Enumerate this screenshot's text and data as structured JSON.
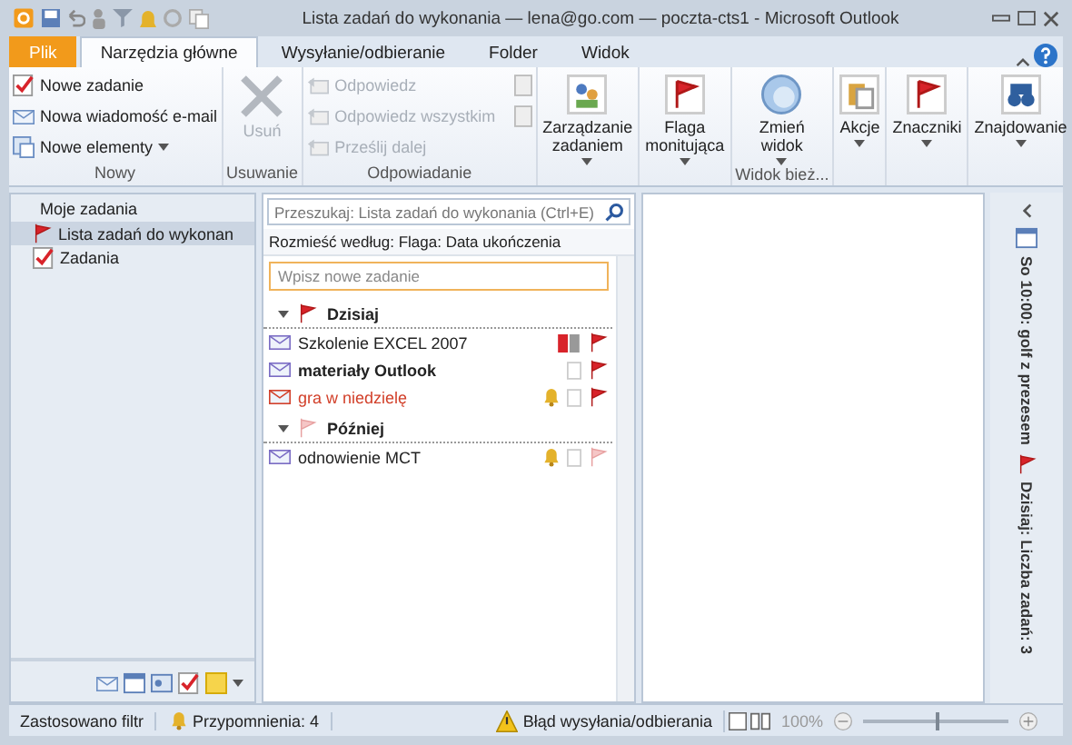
{
  "window": {
    "title": "Lista zadań do wykonania — lena@go.com — poczta-cts1 - Microsoft Outlook"
  },
  "tabs": [
    {
      "label": "Plik",
      "kind": "file",
      "selected": false
    },
    {
      "label": "Narzędzia główne",
      "kind": "tab",
      "selected": true
    },
    {
      "label": "Wysyłanie/odbieranie",
      "kind": "tab",
      "selected": false
    },
    {
      "label": "Folder",
      "kind": "tab",
      "selected": false
    },
    {
      "label": "Widok",
      "kind": "tab",
      "selected": false
    }
  ],
  "ribbon": {
    "groups": [
      {
        "label": "Nowy",
        "kind": "small",
        "buttons": [
          {
            "label": "Nowe zadanie",
            "disabled": false,
            "dropdown": false
          },
          {
            "label": "Nowa wiadomość e-mail",
            "disabled": false,
            "dropdown": false
          },
          {
            "label": "Nowe elementy",
            "disabled": false,
            "dropdown": true
          }
        ]
      },
      {
        "label": "Usuwanie",
        "kind": "large",
        "buttons": [
          {
            "label": "Usuń",
            "disabled": true,
            "dropdown": false
          }
        ]
      },
      {
        "label": "Odpowiadanie",
        "kind": "small",
        "buttons": [
          {
            "label": "Odpowiedz",
            "disabled": true,
            "dropdown": false
          },
          {
            "label": "Odpowiedz wszystkim",
            "disabled": true,
            "dropdown": false
          },
          {
            "label": "Prześlij dalej",
            "disabled": true,
            "dropdown": false
          }
        ]
      },
      {
        "kind": "large",
        "buttons": [
          {
            "label": "Zarządzanie zadaniem",
            "disabled": false,
            "dropdown": true
          }
        ]
      },
      {
        "kind": "large",
        "buttons": [
          {
            "label": "Flaga monitująca",
            "disabled": false,
            "dropdown": true
          }
        ]
      },
      {
        "label": "Widok bież...",
        "kind": "large",
        "buttons": [
          {
            "label": "Zmień widok",
            "disabled": false,
            "dropdown": true
          }
        ]
      },
      {
        "kind": "large",
        "buttons": [
          {
            "label": "Akcje",
            "disabled": false,
            "dropdown": true
          }
        ]
      },
      {
        "kind": "large",
        "buttons": [
          {
            "label": "Znaczniki",
            "disabled": false,
            "dropdown": true
          }
        ]
      },
      {
        "kind": "large",
        "buttons": [
          {
            "label": "Znajdowanie",
            "disabled": false,
            "dropdown": true
          }
        ]
      }
    ]
  },
  "nav": {
    "header": "Moje zadania",
    "items": [
      {
        "label": "Lista zadań do wykonan",
        "kind": "todo",
        "selected": true
      },
      {
        "label": "Zadania",
        "kind": "tasks",
        "selected": false
      }
    ]
  },
  "task_list": {
    "search": {
      "placeholder": "Przeszukaj: Lista zadań do wykonania (Ctrl+E)"
    },
    "arrange_by": "Rozmieść według: Flaga: Data ukończenia",
    "new_task": {
      "placeholder": "Wpisz nowe zadanie"
    },
    "groups": [
      {
        "label": "Dzisiaj",
        "kind": "today",
        "tasks": [
          {
            "subject": "Szkolenie EXCEL 2007",
            "bold": false,
            "overdue": false,
            "reminder": false,
            "categorized": true
          },
          {
            "subject": "materiały Outlook",
            "bold": true,
            "overdue": false,
            "reminder": false,
            "categorized": false
          },
          {
            "subject": "gra w niedzielę",
            "bold": false,
            "overdue": true,
            "reminder": true,
            "categorized": false
          }
        ]
      },
      {
        "label": "Później",
        "kind": "later",
        "tasks": [
          {
            "subject": "odnowienie MCT",
            "bold": false,
            "overdue": false,
            "reminder": true,
            "categorized": false
          }
        ]
      }
    ]
  },
  "todo_bar": {
    "items": [
      {
        "text": "So 10:00: golf z prezesem",
        "kind": "appointment"
      },
      {
        "text": "Dzisiaj: Liczba zadań: 3",
        "kind": "tasks"
      }
    ]
  },
  "status_bar": {
    "filter": "Zastosowano filtr",
    "reminders": "Przypomnienia: 4",
    "error": "Błąd wysyłania/odbierania",
    "zoom": "100%",
    "zoom_slider": {
      "level": 0.5
    }
  }
}
